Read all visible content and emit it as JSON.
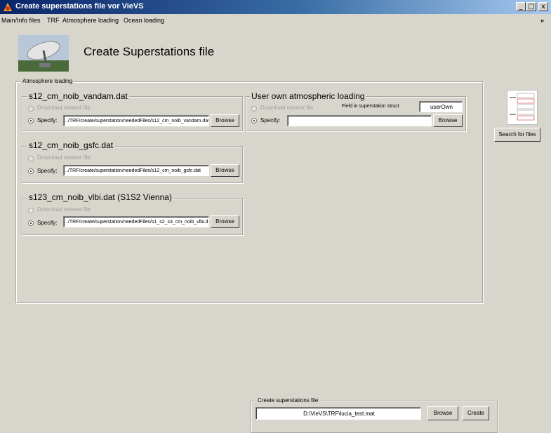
{
  "window": {
    "title": "Create superstations file vor VieVS",
    "min_label": "_",
    "max_label": "□",
    "close_label": "x"
  },
  "menu": {
    "items": [
      "Main/Info files",
      "TRF",
      "Atmosphere loading",
      "Ocean loading"
    ],
    "arrow": "»"
  },
  "header": {
    "title": "Create Superstations file"
  },
  "atmosphere": {
    "section_label": "Atmosphere loading",
    "groups": [
      {
        "title": "s12_cm_noib_vandam.dat",
        "download_label": "Download newest file",
        "specify_label": "Specify:",
        "path": "../TRF/create/superstation/neededFiles/s12_cm_noib_vandam.dat",
        "browse_label": "Browse"
      },
      {
        "title": "s12_cm_noib_gsfc.dat",
        "download_label": "Download newest file",
        "specify_label": "Specify:",
        "path": "../TRF/create/superstation/neededFiles/s12_cm_noib_gsfc.dat",
        "browse_label": "Browse"
      },
      {
        "title": "s123_cm_noib_vlbi.dat (S1S2 Vienna)",
        "download_label": "Download newest file",
        "specify_label": "Specify:",
        "path": "../TRF/create/superstation/neededFiles/s1_s2_s3_cm_noib_vlbi.dat",
        "browse_label": "Browse"
      }
    ],
    "user_own": {
      "title": "User own atmospheric loading",
      "download_label": "Download newest file",
      "field_label": "Field in superstation struct",
      "field_value": "userOwn",
      "specify_label": "Specify:",
      "path": "",
      "browse_label": "Browse"
    }
  },
  "side": {
    "search_label": "Search for files"
  },
  "create": {
    "section_label": "Create superstations file",
    "path": "D:\\VieVS\\TRF\\lucia_test.mat",
    "browse_label": "Browse",
    "create_label": "Create"
  },
  "colors": {
    "face": "#d8d5cd",
    "title_start": "#0a246a",
    "title_end": "#a6caf0"
  },
  "icons": [
    "vievs-logo-icon",
    "minimize-icon",
    "maximize-icon",
    "close-icon",
    "menu-overflow-icon",
    "radio-telescope-icon",
    "file-preview-icon"
  ]
}
